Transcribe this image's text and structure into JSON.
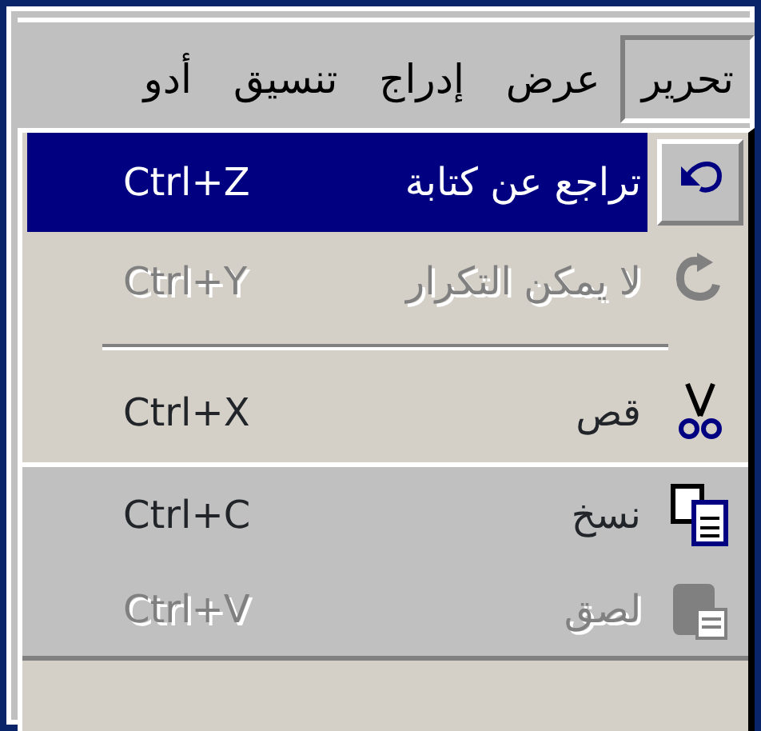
{
  "menu_bar": [
    {
      "label": "تحرير",
      "selected": true
    },
    {
      "label": "عرض",
      "selected": false
    },
    {
      "label": "إدراج",
      "selected": false
    },
    {
      "label": "تنسيق",
      "selected": false
    },
    {
      "label": "أدو",
      "selected": false
    }
  ],
  "menu": [
    {
      "kind": "undo",
      "label": "تراجع عن كتابة",
      "shortcut": "Ctrl+Z",
      "selected": true,
      "disabled": false,
      "rarely_used": false
    },
    {
      "kind": "redo",
      "label": "لا يمكن التكرار",
      "shortcut": "Ctrl+Y",
      "selected": false,
      "disabled": true,
      "rarely_used": false
    },
    {
      "kind": "separator"
    },
    {
      "kind": "cut",
      "label": "قص",
      "shortcut": "Ctrl+X",
      "selected": false,
      "disabled": false,
      "rarely_used": false
    },
    {
      "kind": "copy",
      "label": "نسخ",
      "shortcut": "Ctrl+C",
      "selected": false,
      "disabled": false,
      "rarely_used": true
    },
    {
      "kind": "paste",
      "label": "لصق",
      "shortcut": "Ctrl+V",
      "selected": false,
      "disabled": true,
      "rarely_used": true
    }
  ]
}
